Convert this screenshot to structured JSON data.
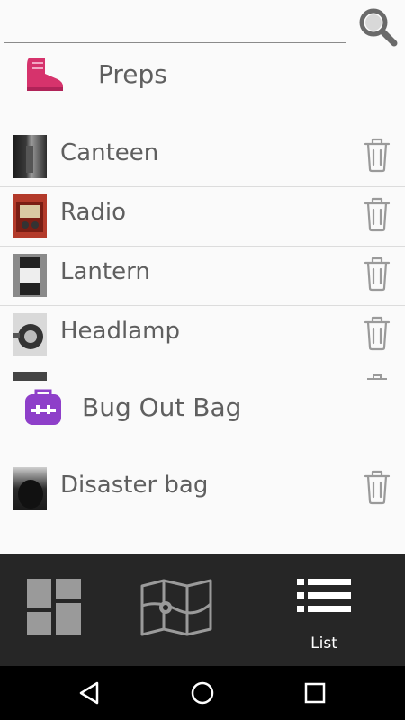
{
  "search": {
    "value": "",
    "placeholder": ""
  },
  "icons": {
    "search": "magnifier-icon",
    "preps_section": "boot-icon",
    "bugout_section": "backpack-icon",
    "delete": "trash-icon",
    "dashboard_tab": "dashboard-grid-icon",
    "map_tab": "map-icon",
    "list_tab": "list-icon",
    "back": "back-triangle-icon",
    "home": "home-circle-icon",
    "recents": "recents-square-icon"
  },
  "colors": {
    "background": "#fafafa",
    "boot_icon": "#d6336c",
    "backpack_icon": "#8e3fc9",
    "nav_bar": "#262626",
    "system_bar": "#000000"
  },
  "sections": [
    {
      "title": "Preps",
      "items": [
        {
          "label": "Canteen"
        },
        {
          "label": "Radio"
        },
        {
          "label": "Lantern"
        },
        {
          "label": "Headlamp"
        }
      ]
    },
    {
      "title": "Bug Out Bag",
      "items": [
        {
          "label": "Disaster bag"
        }
      ]
    }
  ],
  "bottom_nav": {
    "tabs": [
      {
        "label": ""
      },
      {
        "label": ""
      },
      {
        "label": "List",
        "active": true
      }
    ]
  }
}
